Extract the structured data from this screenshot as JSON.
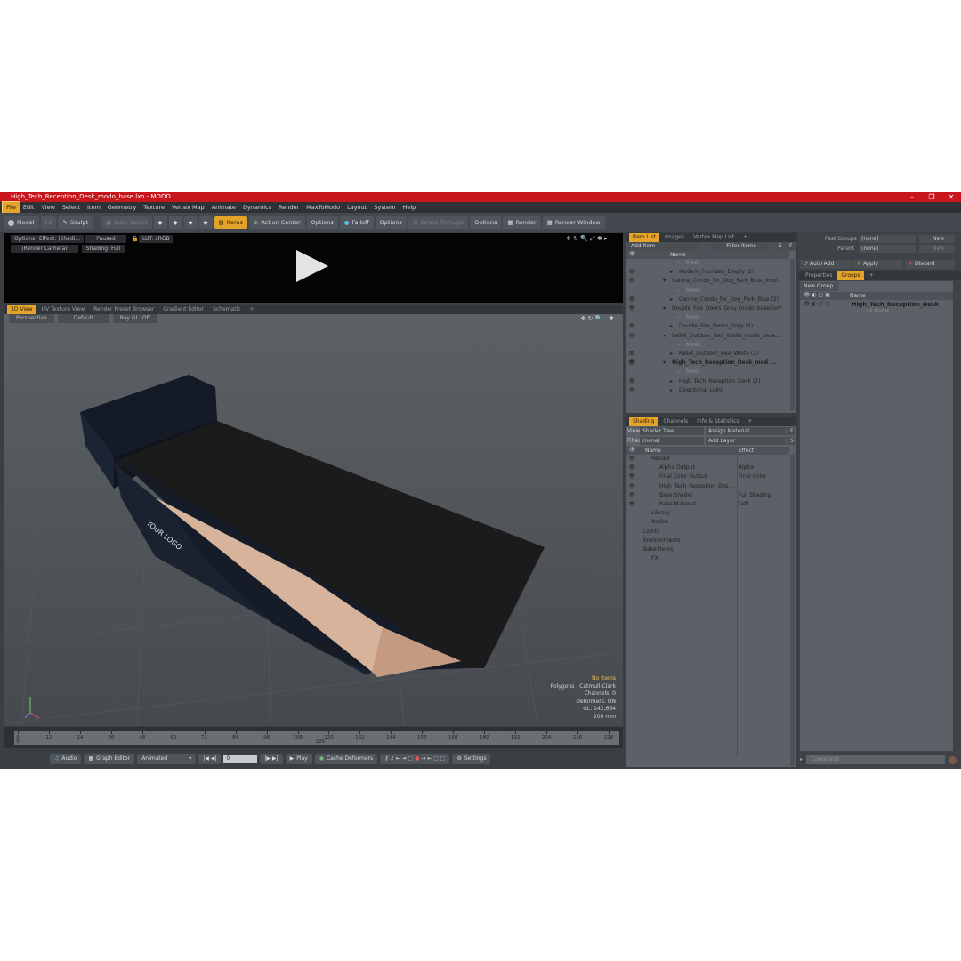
{
  "window": {
    "title": "High_Tech_Reception_Desk_modo_base.lxo - MODO",
    "minimize": "–",
    "maximize": "❐",
    "close": "✕"
  },
  "menu": [
    "File",
    "Edit",
    "View",
    "Select",
    "Item",
    "Geometry",
    "Texture",
    "Vertex Map",
    "Animate",
    "Dynamics",
    "Render",
    "MaxToModo",
    "Layout",
    "System",
    "Help"
  ],
  "toolbar": {
    "model": "Model",
    "f2": "F2",
    "sculpt": "Sculpt",
    "auto_select": "Auto Select",
    "items": "Items",
    "action_center": "Action Center",
    "options1": "Options",
    "falloff": "Falloff",
    "options2": "Options",
    "select_through": "Select Through",
    "options3": "Options",
    "render": "Render",
    "render_window": "Render Window"
  },
  "video": {
    "options": "Options",
    "effect": "Effect: (Shadi...",
    "paused": "Paused",
    "lut": "LUT: sRGB",
    "camera": "(Render Camera)",
    "shading": "Shading: Full"
  },
  "viewport_tabs": [
    "3D View",
    "UV Texture View",
    "Render Preset Browser",
    "Gradient Editor",
    "Schematic",
    "+"
  ],
  "viewport": {
    "projection": "Perspective",
    "style": "Default",
    "raygl": "Ray GL: Off",
    "logo_text": "YOUR LOGO",
    "info": {
      "no_items": "No Items",
      "polygons": "Polygons : Catmull-Clark",
      "channels": "Channels: 0",
      "deformers": "Deformers: ON",
      "gl": "GL: 142,664",
      "scale": "200 mm"
    }
  },
  "timeline": {
    "labels": [
      "0",
      "12",
      "24",
      "36",
      "48",
      "60",
      "72",
      "84",
      "96",
      "108",
      "120",
      "132",
      "144",
      "156",
      "168",
      "180",
      "192",
      "204",
      "216",
      "228"
    ],
    "sub_labels": [
      "0",
      "225"
    ]
  },
  "transport": {
    "audio": "Audio",
    "graph_editor": "Graph Editor",
    "animated": "Animated",
    "frame": "0",
    "play": "Play",
    "cache_deformers": "Cache Deformers",
    "settings": "Settings"
  },
  "item_list": {
    "tabs": [
      "Item List",
      "Images",
      "Vertex Map List",
      "+"
    ],
    "add_item": "Add Item",
    "filter_items": "Filter Items",
    "s": "S",
    "f": "F",
    "name_col": "Name",
    "rows": [
      {
        "name": "Mesh",
        "type": "sub",
        "indent": 3
      },
      {
        "name": "Modern_Fountain_Empty (2)",
        "type": "item",
        "indent": 2
      },
      {
        "name": "Canine_Condo_for_Dog_Park_Blue_mod...",
        "type": "group",
        "indent": 1
      },
      {
        "name": "Mesh",
        "type": "sub",
        "indent": 3
      },
      {
        "name": "Canine_Condo_for_Dog_Park_Blue (2)",
        "type": "item",
        "indent": 2
      },
      {
        "name": "Double_Fire_Doors_Grey_modo_base.lxo*",
        "type": "group",
        "indent": 1
      },
      {
        "name": "Mesh",
        "type": "sub",
        "indent": 3
      },
      {
        "name": "Double_Fire_Doors_Grey (2)",
        "type": "item",
        "indent": 2
      },
      {
        "name": "Pallet_Outdoor_Bed_White_modo_base....",
        "type": "group",
        "indent": 1
      },
      {
        "name": "Mesh",
        "type": "sub",
        "indent": 3
      },
      {
        "name": "Pallet_Outdoor_Bed_White (2)",
        "type": "item",
        "indent": 2
      },
      {
        "name": "High_Tech_Reception_Desk_mod ...",
        "type": "bold",
        "indent": 1
      },
      {
        "name": "Mesh",
        "type": "sub",
        "indent": 3
      },
      {
        "name": "High_Tech_Reception_Desk (2)",
        "type": "item",
        "indent": 2
      },
      {
        "name": "Directional Light",
        "type": "item",
        "indent": 2
      }
    ]
  },
  "shading": {
    "tabs": [
      "Shading",
      "Channels",
      "Info & Statistics",
      "+"
    ],
    "view_label": "View",
    "view_value": "Shader Tree",
    "assign_material": "Assign Material",
    "f": "F",
    "filter_label": "Filter",
    "filter_value": "(none)",
    "add_layer": "Add Layer",
    "s": "S",
    "name_col": "Name",
    "effect_col": "Effect",
    "rows": [
      {
        "name": "Render",
        "effect": "",
        "indent": 1
      },
      {
        "name": "Alpha Output",
        "effect": "Alpha",
        "indent": 2
      },
      {
        "name": "Final Color Output",
        "effect": "Final Color",
        "indent": 2
      },
      {
        "name": "High_Tech_Reception_Des ...",
        "effect": "",
        "indent": 2
      },
      {
        "name": "Base Shader",
        "effect": "Full Shading",
        "indent": 2
      },
      {
        "name": "Base Material",
        "effect": "(all)",
        "indent": 2
      },
      {
        "name": "Library",
        "effect": "",
        "indent": 1
      },
      {
        "name": "Nodes",
        "effect": "",
        "indent": 1
      },
      {
        "name": "Lights",
        "effect": "",
        "indent": 0
      },
      {
        "name": "Environments",
        "effect": "",
        "indent": 0
      },
      {
        "name": "Bake Items",
        "effect": "",
        "indent": 0
      },
      {
        "name": "FX",
        "effect": "",
        "indent": 1
      }
    ]
  },
  "groups": {
    "past_groups": "Past Groups",
    "past_value": "(none)",
    "new": "New",
    "parent": "Parent",
    "parent_value": "(none)",
    "new2": "New",
    "auto_add": "Auto Add",
    "apply": "Apply",
    "discard": "Discard",
    "tabs": [
      "Properties",
      "Groups",
      "+"
    ],
    "new_group": "New Group",
    "name_col": "Name",
    "group_name": "High_Tech_Reception_Desk",
    "group_count": "10 Items"
  },
  "command": {
    "placeholder": "Command"
  },
  "colors": {
    "accent": "#e4a32a",
    "titlebar": "#c8161d",
    "panel": "#5b6166"
  }
}
